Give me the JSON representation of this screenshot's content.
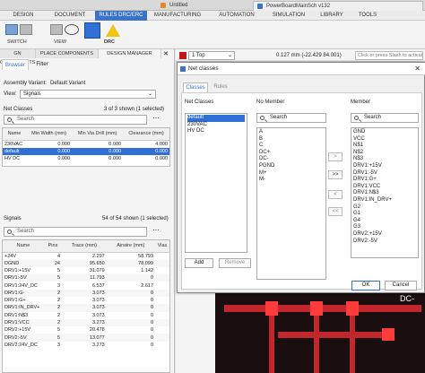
{
  "window_tabs": [
    {
      "label": "Untitled"
    },
    {
      "label": "PowerBoardMainSch v132"
    }
  ],
  "ribbon_tabs": [
    "DESIGN",
    "DOCUMENT",
    "RULES DRC/ERC",
    "MANUFACTURING",
    "AUTOMATION",
    "SIMULATION",
    "LIBRARY",
    "TOOLS"
  ],
  "toolbar": {
    "switch_label": "SWITCH",
    "view_label": "VIEW",
    "drc_label": "DRC"
  },
  "panel_tabs": [
    "GN COMPONENTS",
    "PLACE COMPONENTS",
    "DESIGN MANAGER"
  ],
  "sub_tabs": [
    "Browser",
    "Filter"
  ],
  "assembly": {
    "label": "Assembly Variant:",
    "value": "Default Variant"
  },
  "view": {
    "label": "View:",
    "value": "Signals"
  },
  "net_classes": {
    "title": "Net Classes",
    "count": "3 of 3 shown (1 selected)",
    "search_placeholder": "Search",
    "headers": [
      "Name",
      "Min Width (mm)",
      "Min Via Drill (mm)",
      "Clearance (mm)"
    ],
    "rows": [
      [
        "230VAC",
        "0.000",
        "0.000",
        "4.000"
      ],
      [
        "default",
        "0.000",
        "0.000",
        "0.000"
      ],
      [
        "HV DC",
        "0.000",
        "0.000",
        "0.000"
      ]
    ],
    "selected": 1
  },
  "signals": {
    "title": "Signals",
    "count": "54 of 54 shown (1 selected)",
    "search_placeholder": "Search",
    "headers": [
      "Name",
      "Pins",
      "Trace (mm)",
      "Airwire (mm)",
      "Vias"
    ],
    "rows": [
      [
        "+24V",
        "4",
        "2.297",
        "58.793",
        ""
      ],
      [
        "DGND",
        "24",
        "95.650",
        "78.099",
        ""
      ],
      [
        "DRV1:+15V",
        "5",
        "31.079",
        "1.142",
        ""
      ],
      [
        "DRV1:-5V",
        "5",
        "11.793",
        "0",
        ""
      ],
      [
        "DRV1:24V_DC",
        "3",
        "6.537",
        "2.617",
        ""
      ],
      [
        "DRV1:G-",
        "2",
        "3.073",
        "0",
        ""
      ],
      [
        "DRV1:G+",
        "2",
        "3.073",
        "0",
        ""
      ],
      [
        "DRV1:IN_DRV+",
        "2",
        "3.073",
        "0",
        ""
      ],
      [
        "DRV1:N$3",
        "2",
        "3.073",
        "0",
        ""
      ],
      [
        "DRV1:VCC",
        "2",
        "3.273",
        "0",
        ""
      ],
      [
        "DRV2:+15V",
        "5",
        "20.478",
        "0",
        ""
      ],
      [
        "DRV2:-5V",
        "5",
        "13.077",
        "0",
        ""
      ],
      [
        "DRV2:24V_DC",
        "3",
        "3.273",
        "0",
        ""
      ]
    ]
  },
  "layerbar": {
    "layer": "1 Top",
    "coords": "0.127 mm (-22.429 84.001)",
    "hint": "Click or press Slash to activate co"
  },
  "dialog": {
    "title": "Net classes",
    "tabs": [
      "Classes",
      "Rules"
    ],
    "col_net_classes": "Net Classes",
    "col_no_member": "No Member",
    "col_member": "Member",
    "search_placeholder": "Search",
    "classes": [
      "default",
      "230VAC",
      "HV DC"
    ],
    "selected_class": 0,
    "no_member": [
      "A",
      "B",
      "C",
      "DC+",
      "DC-",
      "PGND",
      "M+",
      "M-"
    ],
    "member": [
      "GND",
      "VCC",
      "N$1",
      "N$2",
      "N$3",
      "DRV1:+15V",
      "DRV1:-5V",
      "DRV1:G+",
      "DRV1:VCC",
      "DRV1:N$3",
      "DRV1:IN_DRV+",
      "G2",
      "G1",
      "G4",
      "G3",
      "DRV2:+15V",
      "DRV2:-5V"
    ],
    "arrows": [
      ">",
      ">>",
      "<",
      "<<"
    ],
    "add_label": "Add",
    "remove_label": "Remove",
    "ok_label": "OK",
    "cancel_label": "Cancel"
  },
  "pcb_label": "DC-",
  "colors": {
    "accent": "#3a72c8",
    "selection": "#2f6fd6",
    "pcb_bg": "#1a0e0e",
    "trace": "#c1272d",
    "layer_swatch": "#c0151b"
  }
}
